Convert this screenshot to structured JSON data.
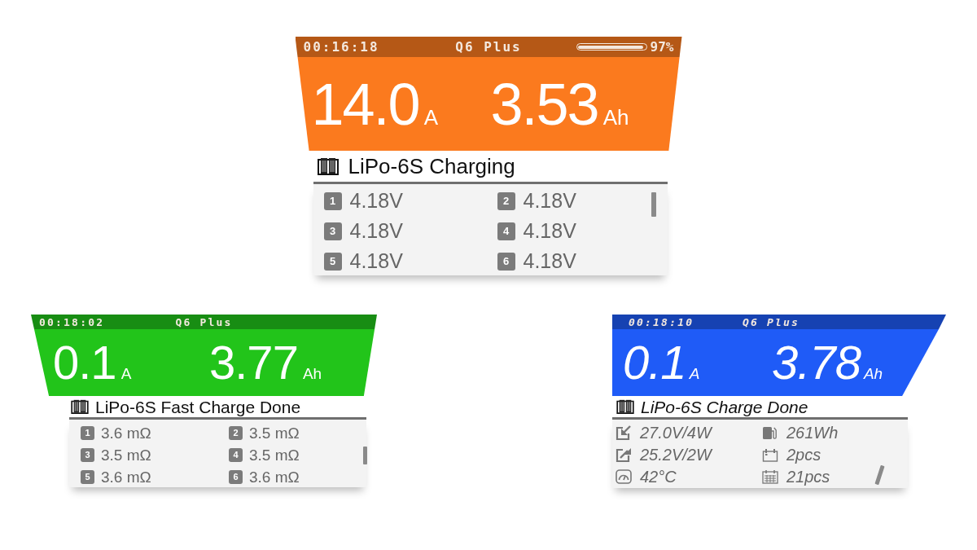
{
  "screens": [
    {
      "kind": "cells",
      "color": "#fb7a1e",
      "italic": false,
      "header": {
        "time": "00:16:18",
        "title": "Q6 Plus",
        "battery": {
          "level": 0.97,
          "reading": "97%"
        }
      },
      "readings": [
        {
          "value": "14.0",
          "unit": "A"
        },
        {
          "value": "3.53",
          "unit": "Ah"
        }
      ],
      "status": "LiPo-6S Charging",
      "items": [
        {
          "number": "1",
          "value": "4.18V"
        },
        {
          "number": "2",
          "value": "4.18V"
        },
        {
          "number": "3",
          "value": "4.18V"
        },
        {
          "number": "4",
          "value": "4.18V"
        },
        {
          "number": "5",
          "value": "4.18V"
        },
        {
          "number": "6",
          "value": "4.18V"
        }
      ]
    },
    {
      "kind": "cells",
      "color": "#22c41a",
      "italic": false,
      "header": {
        "time": "00:18:02",
        "title": "Q6 Plus"
      },
      "readings": [
        {
          "value": "0.1",
          "unit": "A"
        },
        {
          "value": "3.77",
          "unit": "Ah"
        }
      ],
      "status": "LiPo-6S Fast Charge Done",
      "items": [
        {
          "number": "1",
          "value": "3.6 mΩ"
        },
        {
          "number": "2",
          "value": "3.5 mΩ"
        },
        {
          "number": "3",
          "value": "3.5 mΩ"
        },
        {
          "number": "4",
          "value": "3.5 mΩ"
        },
        {
          "number": "5",
          "value": "3.6 mΩ"
        },
        {
          "number": "6",
          "value": "3.6 mΩ"
        }
      ]
    },
    {
      "kind": "stats",
      "color": "#1f5bf7",
      "italic": true,
      "header": {
        "time": "00:18:10",
        "title": "Q6 Plus"
      },
      "readings": [
        {
          "value": "0.1",
          "unit": "A"
        },
        {
          "value": "3.78",
          "unit": "Ah"
        }
      ],
      "status": "LiPo-6S Charge Done",
      "items": [
        {
          "value": "27.0V/4W"
        },
        {
          "value": "261Wh"
        },
        {
          "value": "25.2V/2W"
        },
        {
          "value": "2pcs"
        },
        {
          "value": "42°C"
        },
        {
          "value": "21pcs"
        }
      ]
    }
  ]
}
